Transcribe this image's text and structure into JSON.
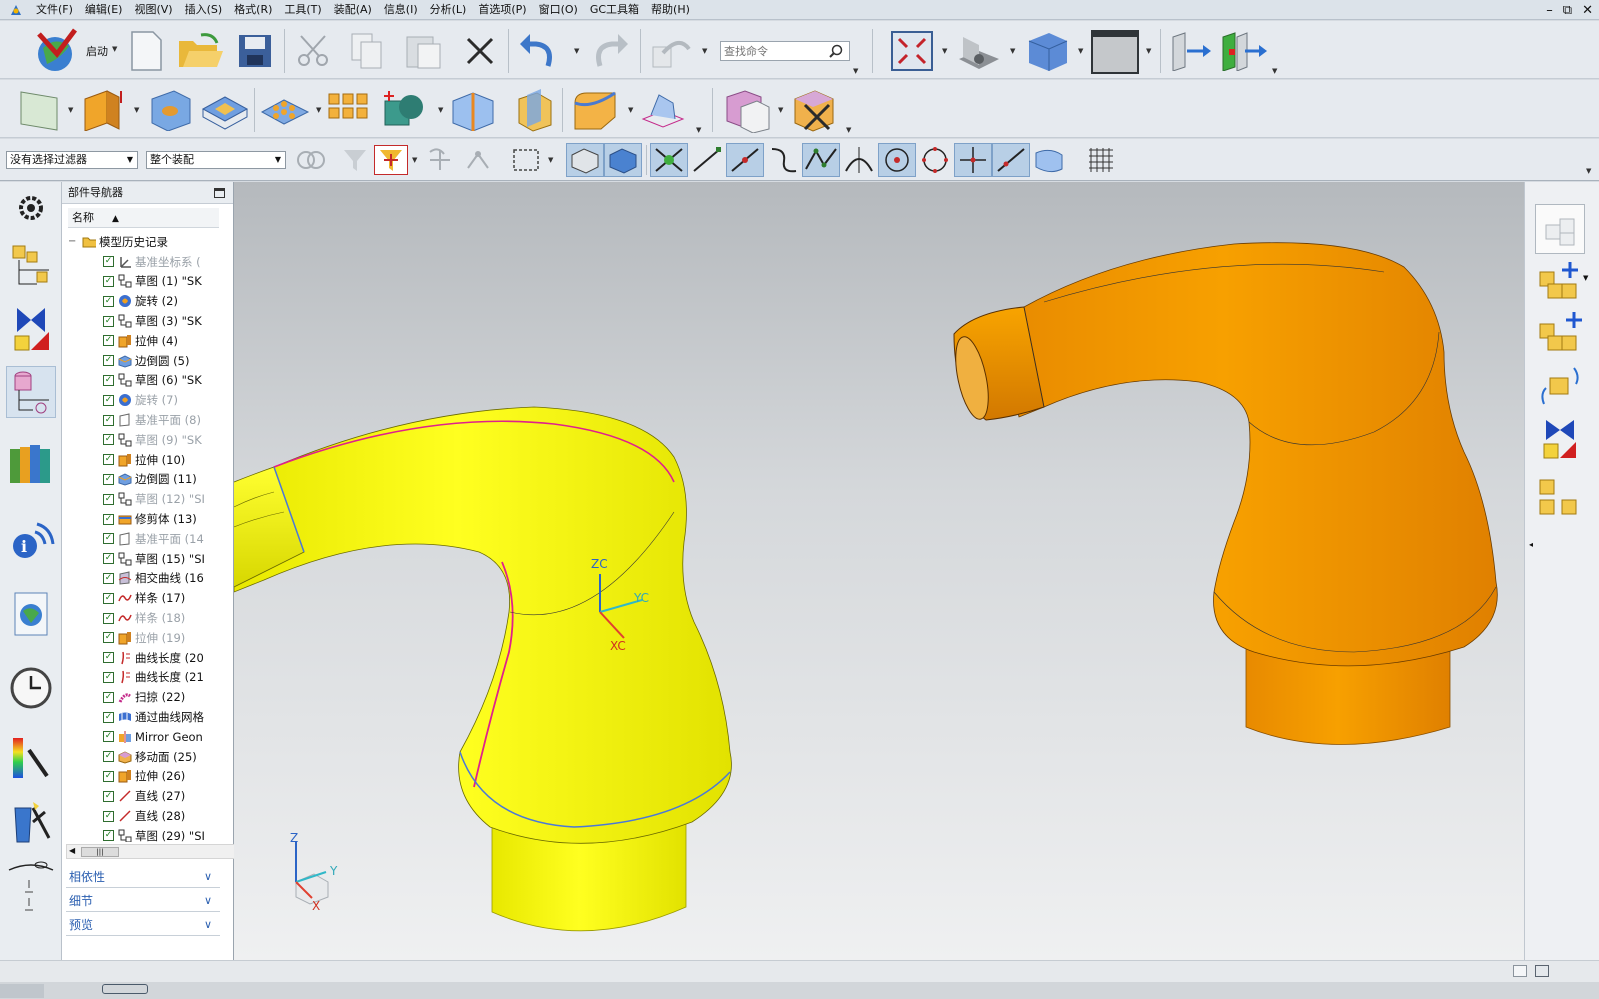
{
  "menubar": {
    "items": [
      "文件(F)",
      "编辑(E)",
      "视图(V)",
      "插入(S)",
      "格式(R)",
      "工具(T)",
      "装配(A)",
      "信息(I)",
      "分析(L)",
      "首选项(P)",
      "窗口(O)",
      "GC工具箱",
      "帮助(H)"
    ],
    "window_controls": [
      "–",
      "⧉",
      "✕"
    ]
  },
  "toolbar": {
    "start_label": "启动",
    "search_placeholder": "查找命令",
    "filter_select": "没有选择过滤器",
    "scope_select": "整个装配"
  },
  "navigator": {
    "title": "部件导航器",
    "column_header": "名称",
    "root": "模型历史记录",
    "items": [
      {
        "label": "基准坐标系 (",
        "icon": "datum-csys-icon",
        "dim": true
      },
      {
        "label": "草图 (1) \"SK",
        "icon": "sketch-icon",
        "dim": false
      },
      {
        "label": "旋转 (2)",
        "icon": "revolve-icon",
        "dim": false
      },
      {
        "label": "草图 (3) \"SK",
        "icon": "sketch-icon",
        "dim": false
      },
      {
        "label": "拉伸 (4)",
        "icon": "extrude-icon",
        "dim": false
      },
      {
        "label": "边倒圆 (5)",
        "icon": "edge-blend-icon",
        "dim": false
      },
      {
        "label": "草图 (6) \"SK",
        "icon": "sketch-icon",
        "dim": false
      },
      {
        "label": "旋转 (7)",
        "icon": "revolve-icon",
        "dim": true
      },
      {
        "label": "基准平面 (8)",
        "icon": "datum-plane-icon",
        "dim": true
      },
      {
        "label": "草图 (9) \"SK",
        "icon": "sketch-icon",
        "dim": true
      },
      {
        "label": "拉伸 (10)",
        "icon": "extrude-icon",
        "dim": false
      },
      {
        "label": "边倒圆 (11)",
        "icon": "edge-blend-icon",
        "dim": false
      },
      {
        "label": "草图 (12) \"SI",
        "icon": "sketch-icon",
        "dim": true
      },
      {
        "label": "修剪体 (13)",
        "icon": "trim-body-icon",
        "dim": false
      },
      {
        "label": "基准平面 (14",
        "icon": "datum-plane-icon",
        "dim": true
      },
      {
        "label": "草图 (15) \"SI",
        "icon": "sketch-icon",
        "dim": false
      },
      {
        "label": "相交曲线 (16",
        "icon": "intersection-curve-icon",
        "dim": false
      },
      {
        "label": "样条 (17)",
        "icon": "spline-icon",
        "dim": false
      },
      {
        "label": "样条 (18)",
        "icon": "spline-icon",
        "dim": true
      },
      {
        "label": "拉伸 (19)",
        "icon": "extrude-icon",
        "dim": true
      },
      {
        "label": "曲线长度 (20",
        "icon": "curve-length-icon",
        "dim": false
      },
      {
        "label": "曲线长度 (21",
        "icon": "curve-length-icon",
        "dim": false
      },
      {
        "label": "扫掠 (22)",
        "icon": "swept-icon",
        "dim": false
      },
      {
        "label": "通过曲线网格",
        "icon": "through-curve-mesh-icon",
        "dim": false
      },
      {
        "label": "Mirror Geon",
        "icon": "mirror-geometry-icon",
        "dim": false
      },
      {
        "label": "移动面 (25)",
        "icon": "move-face-icon",
        "dim": false
      },
      {
        "label": "拉伸 (26)",
        "icon": "extrude-icon",
        "dim": false
      },
      {
        "label": "直线 (27)",
        "icon": "line-icon",
        "dim": false
      },
      {
        "label": "直线 (28)",
        "icon": "line-icon",
        "dim": false
      },
      {
        "label": "草图 (29) \"SI",
        "icon": "sketch-icon",
        "dim": false
      }
    ],
    "sections": [
      "相依性",
      "细节",
      "预览"
    ]
  },
  "viewport": {
    "wcs_labels": {
      "zc": "ZC",
      "yc": "YC",
      "xc": "XC"
    },
    "triad_labels": {
      "z": "Z",
      "y": "Y",
      "x": "X"
    }
  },
  "colors": {
    "yellow_part": "#f2f200",
    "orange_part": "#f39a00",
    "selection": "#e0208c",
    "edge_blue": "#4a78d8"
  }
}
